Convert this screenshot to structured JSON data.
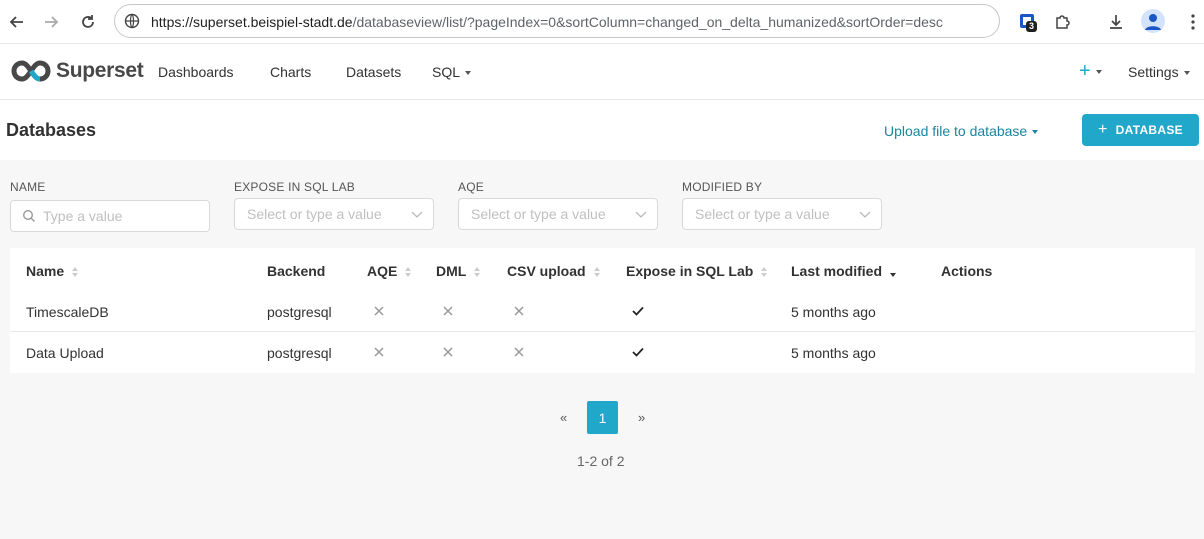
{
  "browser": {
    "url_host": "https://superset.beispiel-stadt.de",
    "url_rest": "/databaseview/list/?pageIndex=0&sortColumn=changed_on_delta_humanized&sortOrder=desc",
    "ext_badge": "3"
  },
  "navbar": {
    "brand": "Superset",
    "items": [
      "Dashboards",
      "Charts",
      "Datasets",
      "SQL"
    ],
    "plus": "+",
    "settings": "Settings"
  },
  "header": {
    "title": "Databases",
    "upload_link": "Upload file to database",
    "add_button": "DATABASE"
  },
  "filters": {
    "name": {
      "label": "NAME",
      "placeholder": "Type a value"
    },
    "expose": {
      "label": "EXPOSE IN SQL LAB",
      "placeholder": "Select or type a value"
    },
    "aqe": {
      "label": "AQE",
      "placeholder": "Select or type a value"
    },
    "modified_by": {
      "label": "MODIFIED BY",
      "placeholder": "Select or type a value"
    }
  },
  "table": {
    "columns": [
      "Name",
      "Backend",
      "AQE",
      "DML",
      "CSV upload",
      "Expose in SQL Lab",
      "Last modified",
      "Actions"
    ],
    "rows": [
      {
        "name": "TimescaleDB",
        "backend": "postgresql",
        "aqe": false,
        "dml": false,
        "csv_upload": false,
        "expose": true,
        "modified": "5 months ago"
      },
      {
        "name": "Data Upload",
        "backend": "postgresql",
        "aqe": false,
        "dml": false,
        "csv_upload": false,
        "expose": true,
        "modified": "5 months ago"
      }
    ]
  },
  "pagination": {
    "prev": "«",
    "current": "1",
    "next": "»",
    "count": "1-2 of 2"
  },
  "colors": {
    "accent": "#20a7c9",
    "link": "#1a85a0"
  }
}
